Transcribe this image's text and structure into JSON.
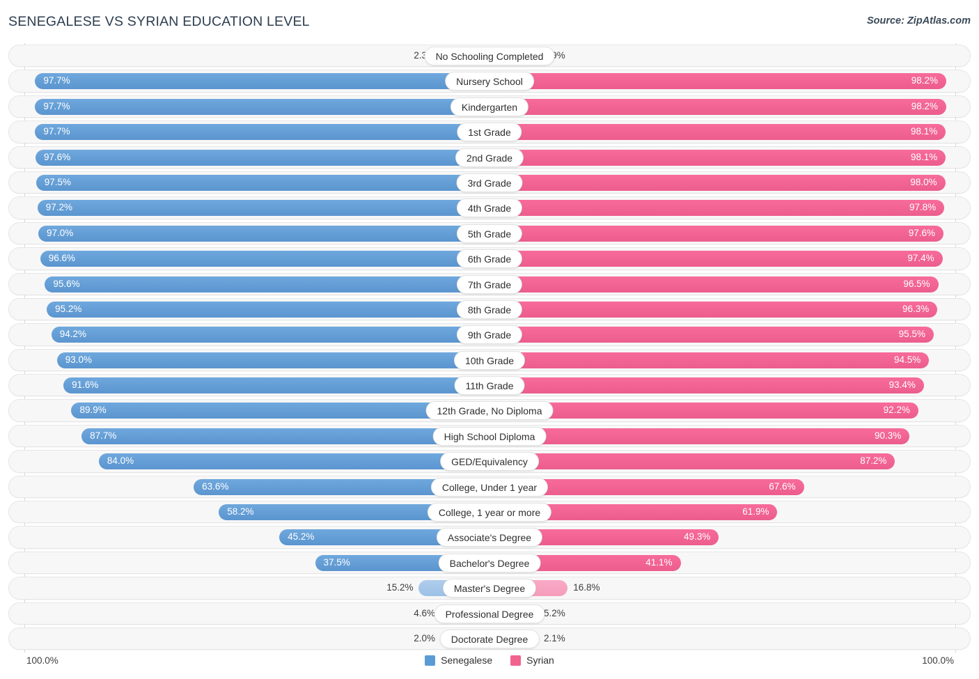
{
  "header": {
    "title": "SENEGALESE VS SYRIAN EDUCATION LEVEL",
    "source": "Source: ZipAtlas.com"
  },
  "footer": {
    "axis_left": "100.0%",
    "axis_right": "100.0%",
    "legend": [
      {
        "label": "Senegalese",
        "color": "#5b9bd5"
      },
      {
        "label": "Syrian",
        "color": "#f2628f"
      }
    ]
  },
  "colors": {
    "left_deep": "#5b9bd5",
    "left_pale": "#a8c8ea",
    "right_deep": "#f2628f",
    "right_pale": "#f6a3c0",
    "track": "#f7f7f7",
    "track_border": "#e6e6e6"
  },
  "chart_data": {
    "type": "bar",
    "title": "SENEGALESE VS SYRIAN EDUCATION LEVEL",
    "subtitle": "Source: ZipAtlas.com",
    "orientation": "horizontal-diverging",
    "xlabel": "",
    "ylabel": "",
    "xlim": [
      0,
      100
    ],
    "axis_tick_labels": [
      "100.0%",
      "100.0%"
    ],
    "grid": false,
    "legend_position": "bottom-center",
    "categories": [
      "No Schooling Completed",
      "Nursery School",
      "Kindergarten",
      "1st Grade",
      "2nd Grade",
      "3rd Grade",
      "4th Grade",
      "5th Grade",
      "6th Grade",
      "7th Grade",
      "8th Grade",
      "9th Grade",
      "10th Grade",
      "11th Grade",
      "12th Grade, No Diploma",
      "High School Diploma",
      "GED/Equivalency",
      "College, Under 1 year",
      "College, 1 year or more",
      "Associate's Degree",
      "Bachelor's Degree",
      "Master's Degree",
      "Professional Degree",
      "Doctorate Degree"
    ],
    "series": [
      {
        "name": "Senegalese",
        "color": "#5b9bd5",
        "side": "left",
        "values": [
          2.3,
          97.7,
          97.7,
          97.7,
          97.6,
          97.5,
          97.2,
          97.0,
          96.6,
          95.6,
          95.2,
          94.2,
          93.0,
          91.6,
          89.9,
          87.7,
          84.0,
          63.6,
          58.2,
          45.2,
          37.5,
          15.2,
          4.6,
          2.0
        ],
        "labels": [
          "2.3%",
          "97.7%",
          "97.7%",
          "97.7%",
          "97.6%",
          "97.5%",
          "97.2%",
          "97.0%",
          "96.6%",
          "95.6%",
          "95.2%",
          "94.2%",
          "93.0%",
          "91.6%",
          "89.9%",
          "87.7%",
          "84.0%",
          "63.6%",
          "58.2%",
          "45.2%",
          "37.5%",
          "15.2%",
          "4.6%",
          "2.0%"
        ]
      },
      {
        "name": "Syrian",
        "color": "#f2628f",
        "side": "right",
        "values": [
          1.9,
          98.2,
          98.2,
          98.1,
          98.1,
          98.0,
          97.8,
          97.6,
          97.4,
          96.5,
          96.3,
          95.5,
          94.5,
          93.4,
          92.2,
          90.3,
          87.2,
          67.6,
          61.9,
          49.3,
          41.1,
          16.8,
          5.2,
          2.1
        ],
        "labels": [
          "1.9%",
          "98.2%",
          "98.2%",
          "98.1%",
          "98.1%",
          "98.0%",
          "97.8%",
          "97.6%",
          "97.4%",
          "96.5%",
          "96.3%",
          "95.5%",
          "94.5%",
          "93.4%",
          "92.2%",
          "90.3%",
          "87.2%",
          "67.6%",
          "61.9%",
          "49.3%",
          "41.1%",
          "16.8%",
          "5.2%",
          "2.1%"
        ]
      }
    ]
  }
}
